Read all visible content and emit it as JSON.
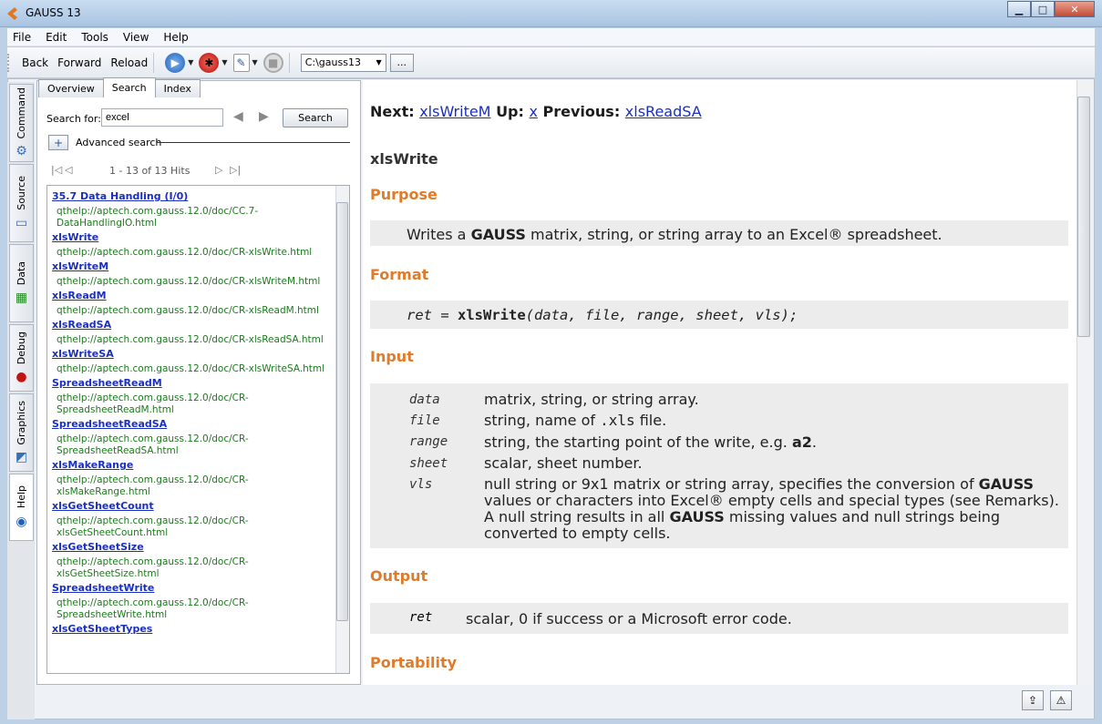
{
  "window": {
    "title": "GAUSS 13"
  },
  "menu": [
    "File",
    "Edit",
    "Tools",
    "View",
    "Help"
  ],
  "toolbar": {
    "back": "Back",
    "forward": "Forward",
    "reload": "Reload",
    "path": "C:\\gauss13",
    "browse": "..."
  },
  "sidebar": [
    "Command",
    "Source",
    "Data",
    "Debug",
    "Graphics",
    "Help"
  ],
  "help_panel": {
    "tabs": [
      "Overview",
      "Search",
      "Index"
    ],
    "search_label": "Search for:",
    "search_value": "excel",
    "search_button": "Search",
    "advanced_label": "Advanced search",
    "hits": "1 - 13 of 13 Hits",
    "results": [
      {
        "title": "35.7 Data Handling (I/0)",
        "url": "qthelp://aptech.com.gauss.12.0/doc/CC.7-DataHandlingIO.html"
      },
      {
        "title": "xlsWrite",
        "url": "qthelp://aptech.com.gauss.12.0/doc/CR-xlsWrite.html"
      },
      {
        "title": "xlsWriteM",
        "url": "qthelp://aptech.com.gauss.12.0/doc/CR-xlsWriteM.html"
      },
      {
        "title": "xlsReadM",
        "url": "qthelp://aptech.com.gauss.12.0/doc/CR-xlsReadM.html"
      },
      {
        "title": "xlsReadSA",
        "url": "qthelp://aptech.com.gauss.12.0/doc/CR-xlsReadSA.html"
      },
      {
        "title": "xlsWriteSA",
        "url": "qthelp://aptech.com.gauss.12.0/doc/CR-xlsWriteSA.html"
      },
      {
        "title": "SpreadsheetReadM",
        "url": "qthelp://aptech.com.gauss.12.0/doc/CR-SpreadsheetReadM.html"
      },
      {
        "title": "SpreadsheetReadSA",
        "url": "qthelp://aptech.com.gauss.12.0/doc/CR-SpreadsheetReadSA.html"
      },
      {
        "title": "xlsMakeRange",
        "url": "qthelp://aptech.com.gauss.12.0/doc/CR-xlsMakeRange.html"
      },
      {
        "title": "xlsGetSheetCount",
        "url": "qthelp://aptech.com.gauss.12.0/doc/CR-xlsGetSheetCount.html"
      },
      {
        "title": "xlsGetSheetSize",
        "url": "qthelp://aptech.com.gauss.12.0/doc/CR-xlsGetSheetSize.html"
      },
      {
        "title": "SpreadsheetWrite",
        "url": "qthelp://aptech.com.gauss.12.0/doc/CR-SpreadsheetWrite.html"
      },
      {
        "title": "xlsGetSheetTypes",
        "url": ""
      }
    ]
  },
  "doc": {
    "next_label": "Next:",
    "next_link": "xlsWriteM",
    "up_label": "Up:",
    "up_link": "x",
    "prev_label": "Previous:",
    "prev_link": "xlsReadSA",
    "title": "xlsWrite",
    "purpose_heading": "Purpose",
    "purpose_pre": "Writes a ",
    "purpose_bold": "GAUSS",
    "purpose_post": " matrix, string, or string array to an Excel® spreadsheet.",
    "format_heading": "Format",
    "format_ret": "ret",
    "format_eq": " = ",
    "format_fn": "xlsWrite",
    "format_args": "(data, file, range, sheet, vls);",
    "input_heading": "Input",
    "inputs": [
      {
        "name": "data",
        "desc": "matrix, string, or string array."
      },
      {
        "name": "file",
        "desc": "string, name of .xls file."
      },
      {
        "name": "range",
        "desc": "string, the starting point of the write, e.g. a2."
      },
      {
        "name": "sheet",
        "desc": "scalar, sheet number."
      },
      {
        "name": "vls",
        "desc": "null string or 9x1 matrix or string array, specifies the conversion of GAUSS values or characters into Excel® empty cells and special types (see Remarks). A null string results in all GAUSS missing values and null strings being converted to empty cells."
      }
    ],
    "output_heading": "Output",
    "output_name": "ret",
    "output_desc": "scalar, 0 if success or a Microsoft error code.",
    "portability_heading": "Portability"
  }
}
